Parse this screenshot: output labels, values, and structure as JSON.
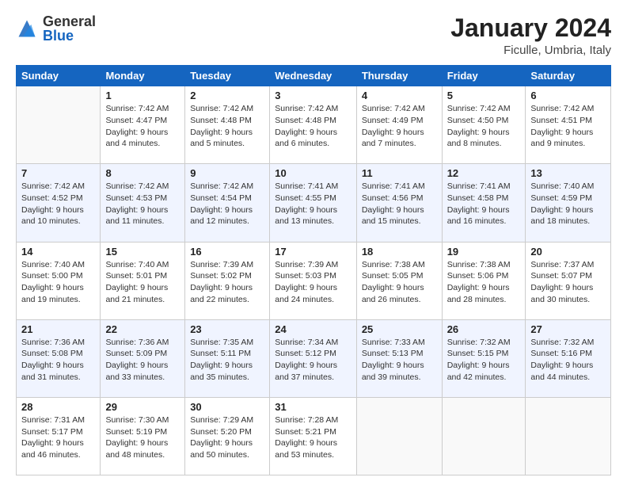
{
  "logo": {
    "general": "General",
    "blue": "Blue"
  },
  "title": "January 2024",
  "location": "Ficulle, Umbria, Italy",
  "weekdays": [
    "Sunday",
    "Monday",
    "Tuesday",
    "Wednesday",
    "Thursday",
    "Friday",
    "Saturday"
  ],
  "weeks": [
    [
      {
        "day": "",
        "sunrise": "",
        "sunset": "",
        "daylight": ""
      },
      {
        "day": "1",
        "sunrise": "Sunrise: 7:42 AM",
        "sunset": "Sunset: 4:47 PM",
        "daylight": "Daylight: 9 hours and 4 minutes."
      },
      {
        "day": "2",
        "sunrise": "Sunrise: 7:42 AM",
        "sunset": "Sunset: 4:48 PM",
        "daylight": "Daylight: 9 hours and 5 minutes."
      },
      {
        "day": "3",
        "sunrise": "Sunrise: 7:42 AM",
        "sunset": "Sunset: 4:48 PM",
        "daylight": "Daylight: 9 hours and 6 minutes."
      },
      {
        "day": "4",
        "sunrise": "Sunrise: 7:42 AM",
        "sunset": "Sunset: 4:49 PM",
        "daylight": "Daylight: 9 hours and 7 minutes."
      },
      {
        "day": "5",
        "sunrise": "Sunrise: 7:42 AM",
        "sunset": "Sunset: 4:50 PM",
        "daylight": "Daylight: 9 hours and 8 minutes."
      },
      {
        "day": "6",
        "sunrise": "Sunrise: 7:42 AM",
        "sunset": "Sunset: 4:51 PM",
        "daylight": "Daylight: 9 hours and 9 minutes."
      }
    ],
    [
      {
        "day": "7",
        "sunrise": "Sunrise: 7:42 AM",
        "sunset": "Sunset: 4:52 PM",
        "daylight": "Daylight: 9 hours and 10 minutes."
      },
      {
        "day": "8",
        "sunrise": "Sunrise: 7:42 AM",
        "sunset": "Sunset: 4:53 PM",
        "daylight": "Daylight: 9 hours and 11 minutes."
      },
      {
        "day": "9",
        "sunrise": "Sunrise: 7:42 AM",
        "sunset": "Sunset: 4:54 PM",
        "daylight": "Daylight: 9 hours and 12 minutes."
      },
      {
        "day": "10",
        "sunrise": "Sunrise: 7:41 AM",
        "sunset": "Sunset: 4:55 PM",
        "daylight": "Daylight: 9 hours and 13 minutes."
      },
      {
        "day": "11",
        "sunrise": "Sunrise: 7:41 AM",
        "sunset": "Sunset: 4:56 PM",
        "daylight": "Daylight: 9 hours and 15 minutes."
      },
      {
        "day": "12",
        "sunrise": "Sunrise: 7:41 AM",
        "sunset": "Sunset: 4:58 PM",
        "daylight": "Daylight: 9 hours and 16 minutes."
      },
      {
        "day": "13",
        "sunrise": "Sunrise: 7:40 AM",
        "sunset": "Sunset: 4:59 PM",
        "daylight": "Daylight: 9 hours and 18 minutes."
      }
    ],
    [
      {
        "day": "14",
        "sunrise": "Sunrise: 7:40 AM",
        "sunset": "Sunset: 5:00 PM",
        "daylight": "Daylight: 9 hours and 19 minutes."
      },
      {
        "day": "15",
        "sunrise": "Sunrise: 7:40 AM",
        "sunset": "Sunset: 5:01 PM",
        "daylight": "Daylight: 9 hours and 21 minutes."
      },
      {
        "day": "16",
        "sunrise": "Sunrise: 7:39 AM",
        "sunset": "Sunset: 5:02 PM",
        "daylight": "Daylight: 9 hours and 22 minutes."
      },
      {
        "day": "17",
        "sunrise": "Sunrise: 7:39 AM",
        "sunset": "Sunset: 5:03 PM",
        "daylight": "Daylight: 9 hours and 24 minutes."
      },
      {
        "day": "18",
        "sunrise": "Sunrise: 7:38 AM",
        "sunset": "Sunset: 5:05 PM",
        "daylight": "Daylight: 9 hours and 26 minutes."
      },
      {
        "day": "19",
        "sunrise": "Sunrise: 7:38 AM",
        "sunset": "Sunset: 5:06 PM",
        "daylight": "Daylight: 9 hours and 28 minutes."
      },
      {
        "day": "20",
        "sunrise": "Sunrise: 7:37 AM",
        "sunset": "Sunset: 5:07 PM",
        "daylight": "Daylight: 9 hours and 30 minutes."
      }
    ],
    [
      {
        "day": "21",
        "sunrise": "Sunrise: 7:36 AM",
        "sunset": "Sunset: 5:08 PM",
        "daylight": "Daylight: 9 hours and 31 minutes."
      },
      {
        "day": "22",
        "sunrise": "Sunrise: 7:36 AM",
        "sunset": "Sunset: 5:09 PM",
        "daylight": "Daylight: 9 hours and 33 minutes."
      },
      {
        "day": "23",
        "sunrise": "Sunrise: 7:35 AM",
        "sunset": "Sunset: 5:11 PM",
        "daylight": "Daylight: 9 hours and 35 minutes."
      },
      {
        "day": "24",
        "sunrise": "Sunrise: 7:34 AM",
        "sunset": "Sunset: 5:12 PM",
        "daylight": "Daylight: 9 hours and 37 minutes."
      },
      {
        "day": "25",
        "sunrise": "Sunrise: 7:33 AM",
        "sunset": "Sunset: 5:13 PM",
        "daylight": "Daylight: 9 hours and 39 minutes."
      },
      {
        "day": "26",
        "sunrise": "Sunrise: 7:32 AM",
        "sunset": "Sunset: 5:15 PM",
        "daylight": "Daylight: 9 hours and 42 minutes."
      },
      {
        "day": "27",
        "sunrise": "Sunrise: 7:32 AM",
        "sunset": "Sunset: 5:16 PM",
        "daylight": "Daylight: 9 hours and 44 minutes."
      }
    ],
    [
      {
        "day": "28",
        "sunrise": "Sunrise: 7:31 AM",
        "sunset": "Sunset: 5:17 PM",
        "daylight": "Daylight: 9 hours and 46 minutes."
      },
      {
        "day": "29",
        "sunrise": "Sunrise: 7:30 AM",
        "sunset": "Sunset: 5:19 PM",
        "daylight": "Daylight: 9 hours and 48 minutes."
      },
      {
        "day": "30",
        "sunrise": "Sunrise: 7:29 AM",
        "sunset": "Sunset: 5:20 PM",
        "daylight": "Daylight: 9 hours and 50 minutes."
      },
      {
        "day": "31",
        "sunrise": "Sunrise: 7:28 AM",
        "sunset": "Sunset: 5:21 PM",
        "daylight": "Daylight: 9 hours and 53 minutes."
      },
      {
        "day": "",
        "sunrise": "",
        "sunset": "",
        "daylight": ""
      },
      {
        "day": "",
        "sunrise": "",
        "sunset": "",
        "daylight": ""
      },
      {
        "day": "",
        "sunrise": "",
        "sunset": "",
        "daylight": ""
      }
    ]
  ]
}
